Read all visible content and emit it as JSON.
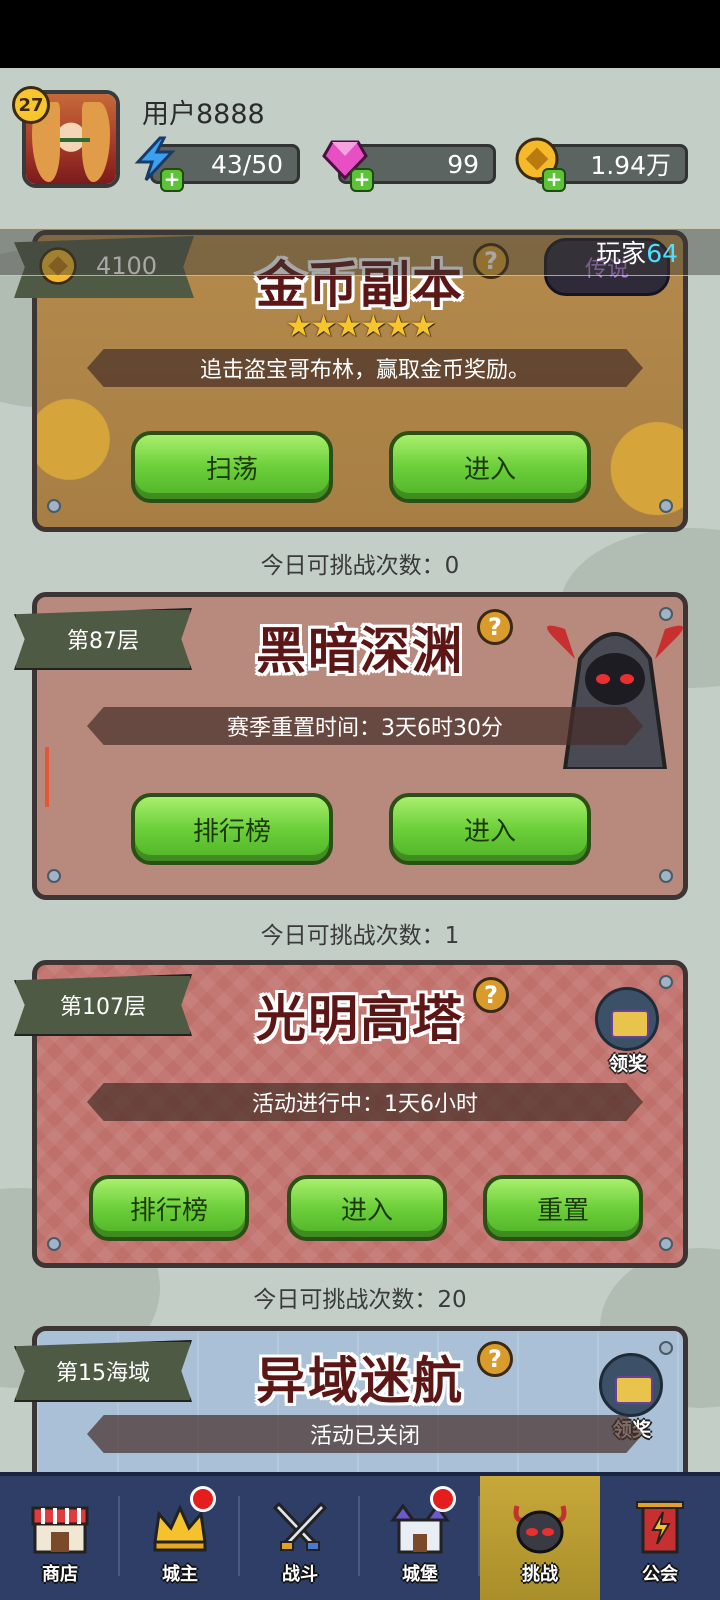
{
  "header": {
    "level": "27",
    "username": "用户8888",
    "energy": "43/50",
    "gems": "99",
    "coins": "1.94万"
  },
  "player_banner": {
    "label": "玩家",
    "count": "64"
  },
  "cards": [
    {
      "id": "gold",
      "title": "金币副本",
      "badge_value": "4100",
      "tier": "传说",
      "stars": 6,
      "description": "追击盗宝哥布林，赢取金币奖励。",
      "buttons": [
        "扫荡",
        "进入"
      ],
      "count_label": "今日可挑战次数：0"
    },
    {
      "id": "abyss",
      "title": "黑暗深渊",
      "floor": "第87层",
      "description": "赛季重置时间：3天6时30分",
      "buttons": [
        "排行榜",
        "进入"
      ],
      "count_label": "今日可挑战次数：1"
    },
    {
      "id": "tower",
      "title": "光明高塔",
      "floor": "第107层",
      "description": "活动进行中：1天6小时",
      "reward_label": "领奖",
      "buttons": [
        "排行榜",
        "进入",
        "重置"
      ],
      "count_label": "今日可挑战次数：20"
    },
    {
      "id": "voyage",
      "title": "异域迷航",
      "floor": "第15海域",
      "description": "活动已关闭",
      "reward_label": "领奖"
    }
  ],
  "nav": {
    "items": [
      {
        "label": "商店",
        "icon": "shop-icon"
      },
      {
        "label": "城主",
        "icon": "crown-icon",
        "dot": true
      },
      {
        "label": "战斗",
        "icon": "swords-icon"
      },
      {
        "label": "城堡",
        "icon": "castle-icon",
        "dot": true
      },
      {
        "label": "挑战",
        "icon": "demon-mask-icon",
        "active": true
      },
      {
        "label": "公会",
        "icon": "guild-banner-icon"
      }
    ]
  },
  "colors": {
    "green_button": "#6ccf3a",
    "title_text": "#5c1616",
    "nav_bg": "#2e3e66",
    "nav_active": "#c7a83a"
  }
}
